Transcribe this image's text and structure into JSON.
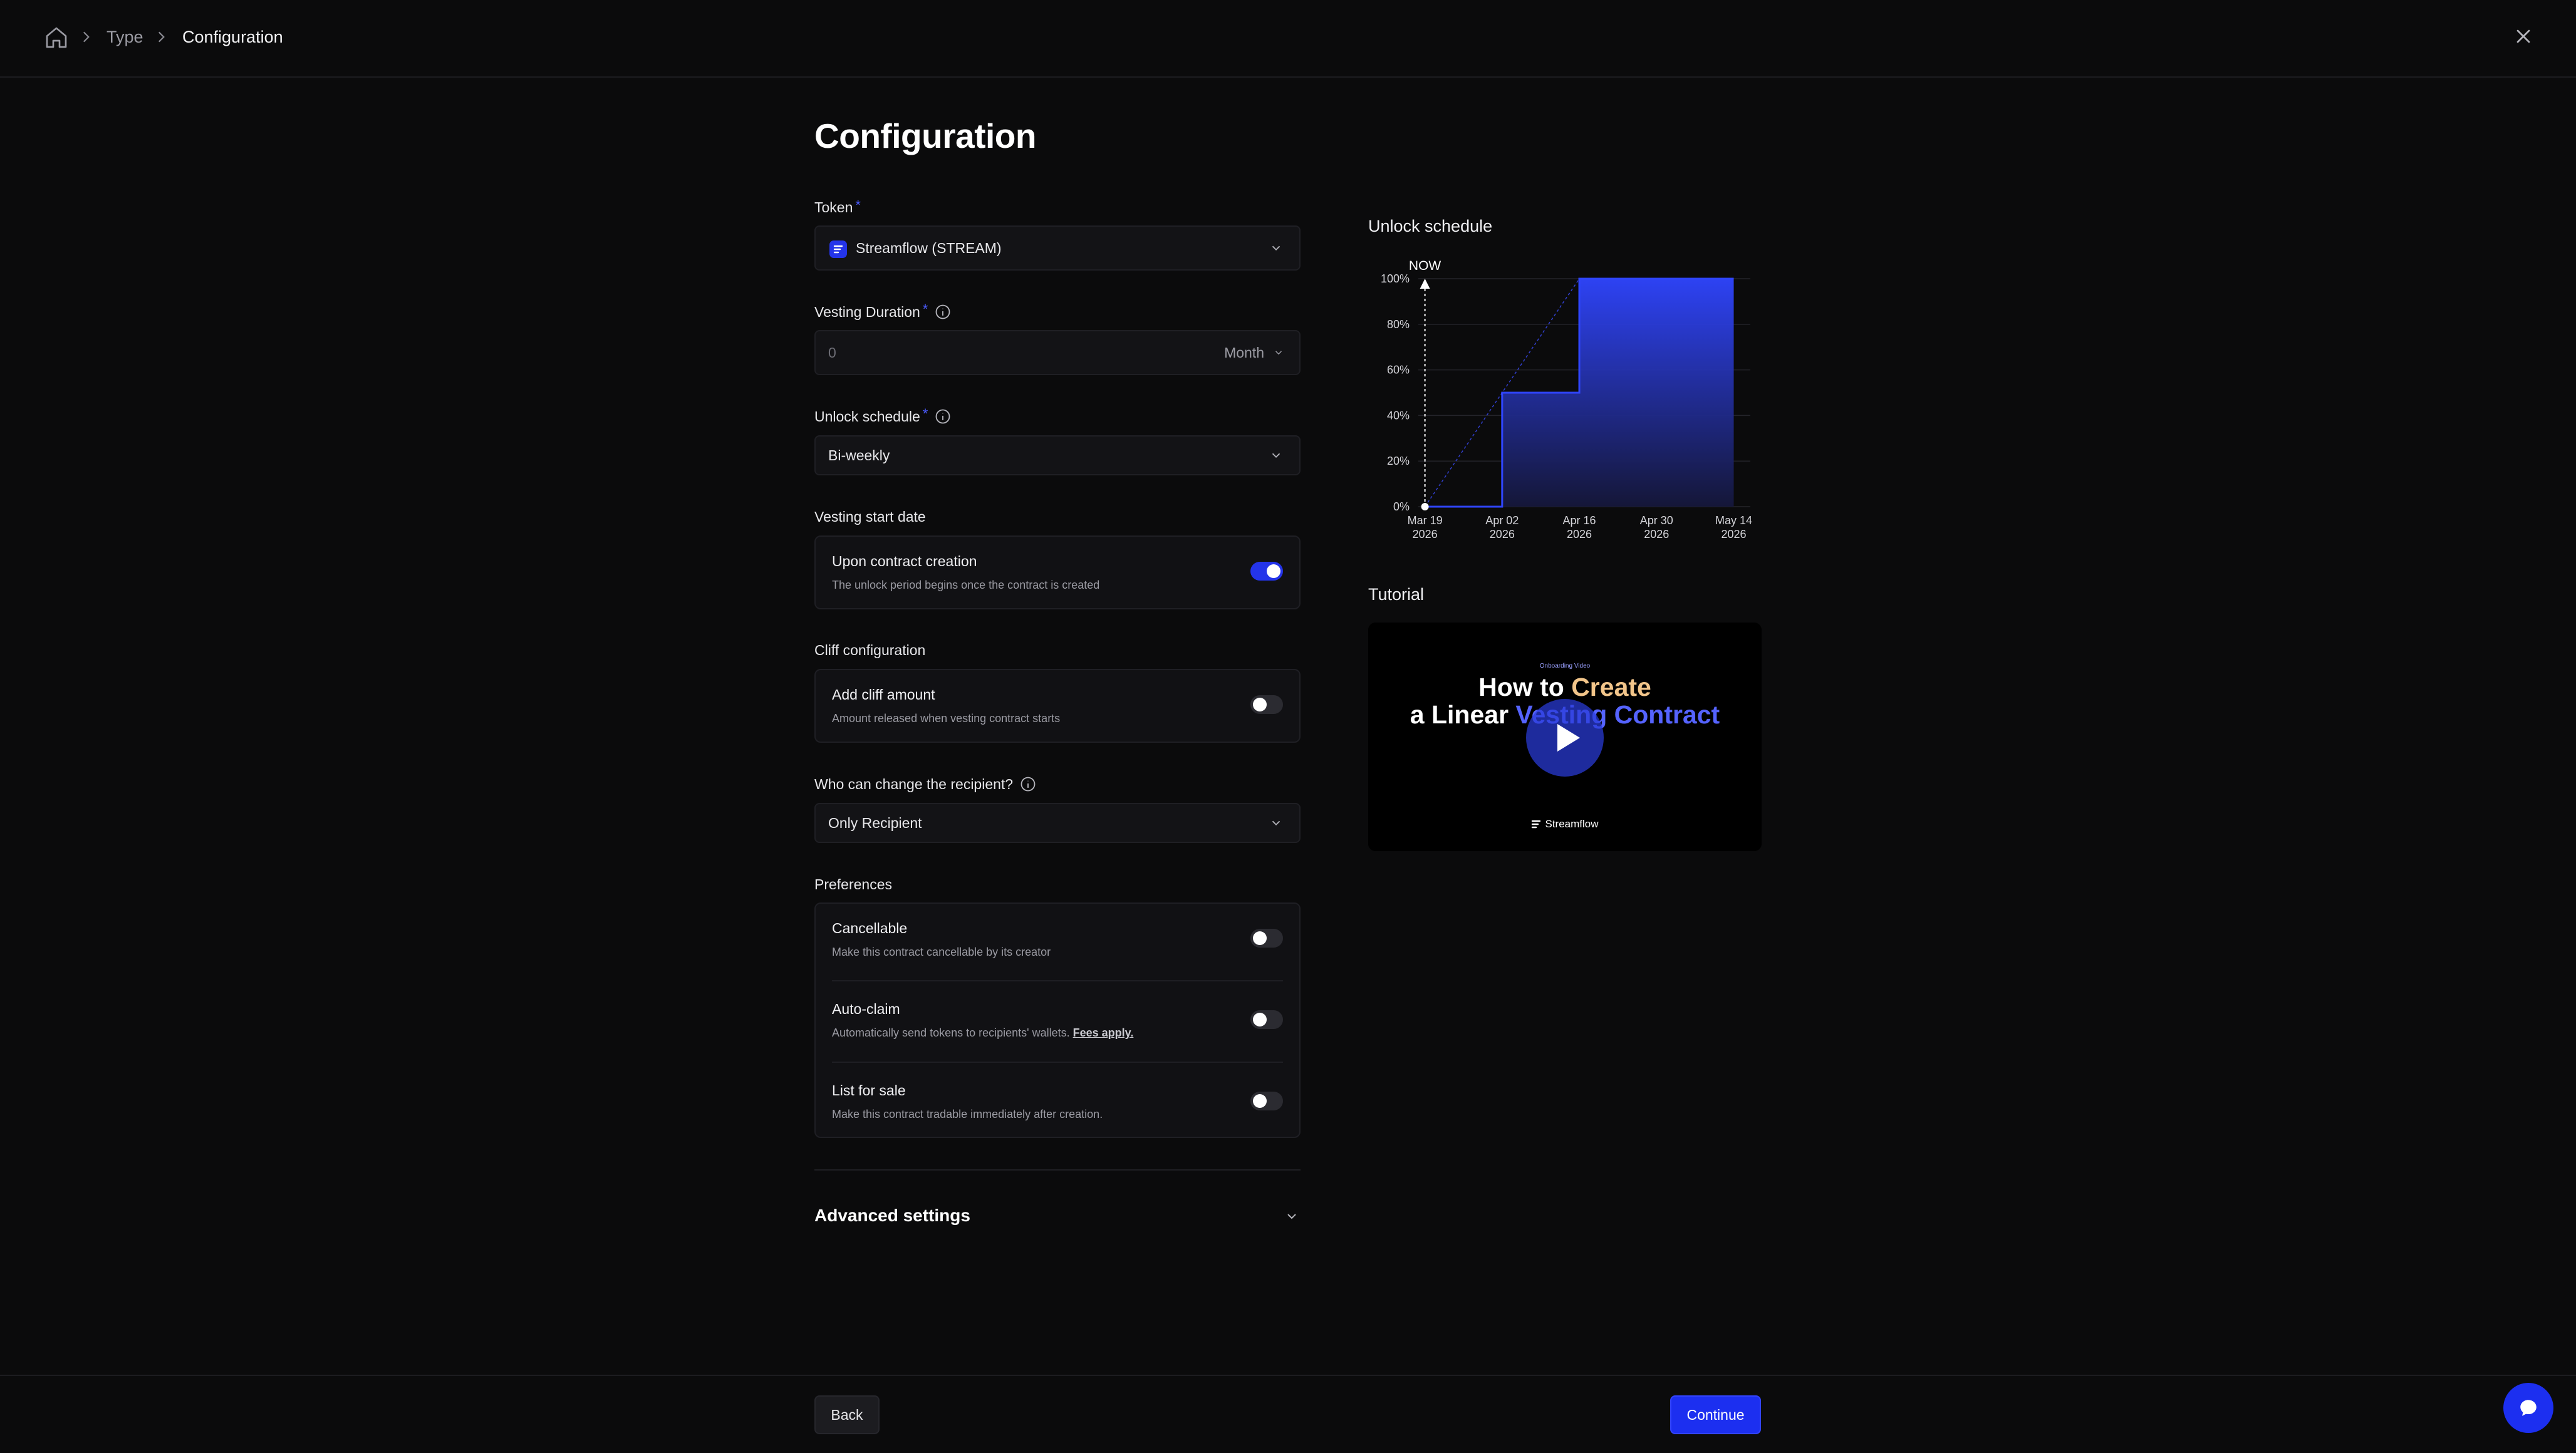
{
  "breadcrumb": {
    "items": [
      "Type",
      "Configuration"
    ]
  },
  "page": {
    "title": "Configuration"
  },
  "form": {
    "token": {
      "label": "Token",
      "required_mark": "*",
      "value": "Streamflow (STREAM)"
    },
    "vesting_duration": {
      "label": "Vesting Duration",
      "required_mark": "*",
      "placeholder": "0",
      "unit": "Month"
    },
    "unlock_schedule": {
      "label": "Unlock schedule",
      "required_mark": "*",
      "value": "Bi-weekly"
    },
    "start_date": {
      "label": "Vesting start date",
      "title": "Upon contract creation",
      "desc": "The unlock period begins once the contract is created",
      "enabled": true
    },
    "cliff": {
      "label": "Cliff configuration",
      "title": "Add cliff amount",
      "desc": "Amount released when vesting contract starts",
      "enabled": false
    },
    "recipient": {
      "label": "Who can change the recipient?",
      "value": "Only Recipient"
    },
    "preferences": {
      "label": "Preferences",
      "items": [
        {
          "title": "Cancellable",
          "desc": "Make this contract cancellable by its creator",
          "enabled": false
        },
        {
          "title": "Auto-claim",
          "desc": "Automatically send tokens to recipients' wallets.",
          "link": "Fees apply.",
          "enabled": false
        },
        {
          "title": "List for sale",
          "desc": "Make this contract tradable immediately after creation.",
          "enabled": false
        }
      ]
    },
    "advanced": "Advanced settings"
  },
  "sidebar": {
    "schedule_title": "Unlock schedule",
    "tutorial_title": "Tutorial",
    "video": {
      "kicker": "Onboarding Video",
      "line1_a": "How to ",
      "line1_b": "Create",
      "line2_a": "a Linear ",
      "line2_b": "Vesting Contract",
      "brand": "Streamflow"
    }
  },
  "chart_data": {
    "type": "area",
    "title": "Unlock schedule",
    "x_ticks": [
      {
        "d": "Mar 19",
        "y": "2026"
      },
      {
        "d": "Apr 02",
        "y": "2026"
      },
      {
        "d": "Apr 16",
        "y": "2026"
      },
      {
        "d": "Apr 30",
        "y": "2026"
      },
      {
        "d": "May 14",
        "y": "2026"
      }
    ],
    "y_ticks": [
      "0%",
      "20%",
      "40%",
      "60%",
      "80%",
      "100%"
    ],
    "ylim": [
      0,
      100
    ],
    "step_series": [
      {
        "x": "Mar 19 2026",
        "y": 0
      },
      {
        "x": "Apr 02 2026",
        "y": 0
      },
      {
        "x": "Apr 02 2026",
        "y": 50
      },
      {
        "x": "Apr 16 2026",
        "y": 50
      },
      {
        "x": "Apr 16 2026",
        "y": 100
      },
      {
        "x": "May 14 2026",
        "y": 100
      }
    ],
    "linear_series": [
      {
        "x": "Mar 19 2026",
        "y": 0
      },
      {
        "x": "Apr 16 2026",
        "y": 100
      }
    ],
    "now_marker": {
      "label": "NOW",
      "x": "Mar 19 2026"
    },
    "grid": true,
    "accent": "#2f45ff"
  },
  "footer": {
    "back": "Back",
    "continue": "Continue"
  },
  "icons": {
    "home": "home-icon",
    "chevron": "chevron-right-icon",
    "close": "close-icon",
    "info": "info-icon",
    "chat": "chat-icon",
    "play": "play-icon"
  },
  "colors": {
    "accent": "#1c2ff0",
    "background": "#0b0b0c"
  }
}
